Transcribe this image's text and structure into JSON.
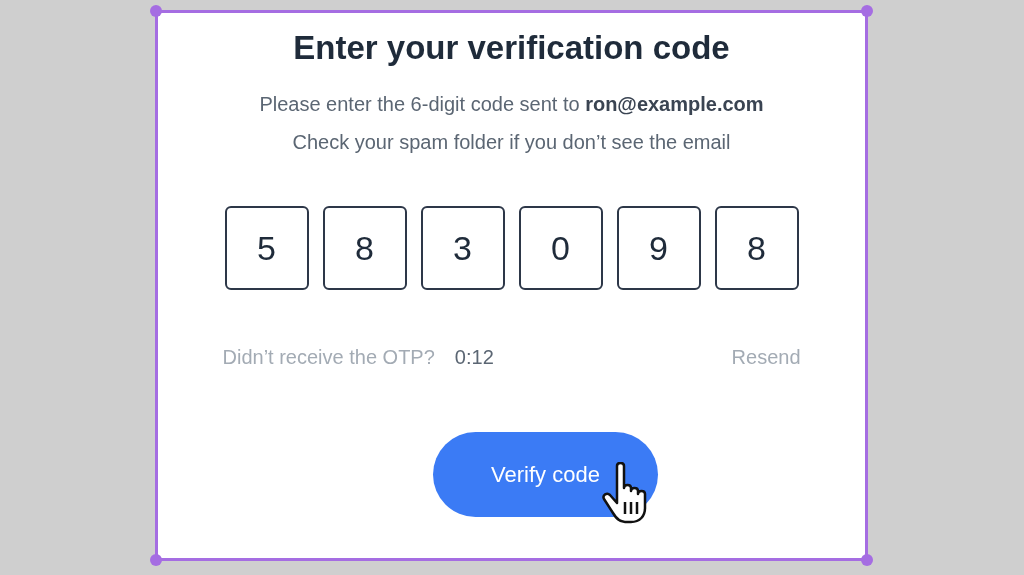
{
  "title": "Enter your verification code",
  "instructions": [
    "Please enter the 6-digit code sent to **ron@example.com**",
    "Check your spam folder if you don’t see the email"
  ],
  "code_boxes": [
    {
      "digit": "5"
    },
    {
      "digit": "8"
    },
    {
      "digit": "3"
    },
    {
      "digit": "0"
    },
    {
      "digit": "9"
    },
    {
      "digit": "8"
    }
  ],
  "resend_row": {
    "prompt": "Didn’t receive the OTP?",
    "timer": "0:12",
    "resend": {
      "label": "Resend",
      "disabled": true
    }
  },
  "verify_button": {
    "label": "Verify code"
  }
}
